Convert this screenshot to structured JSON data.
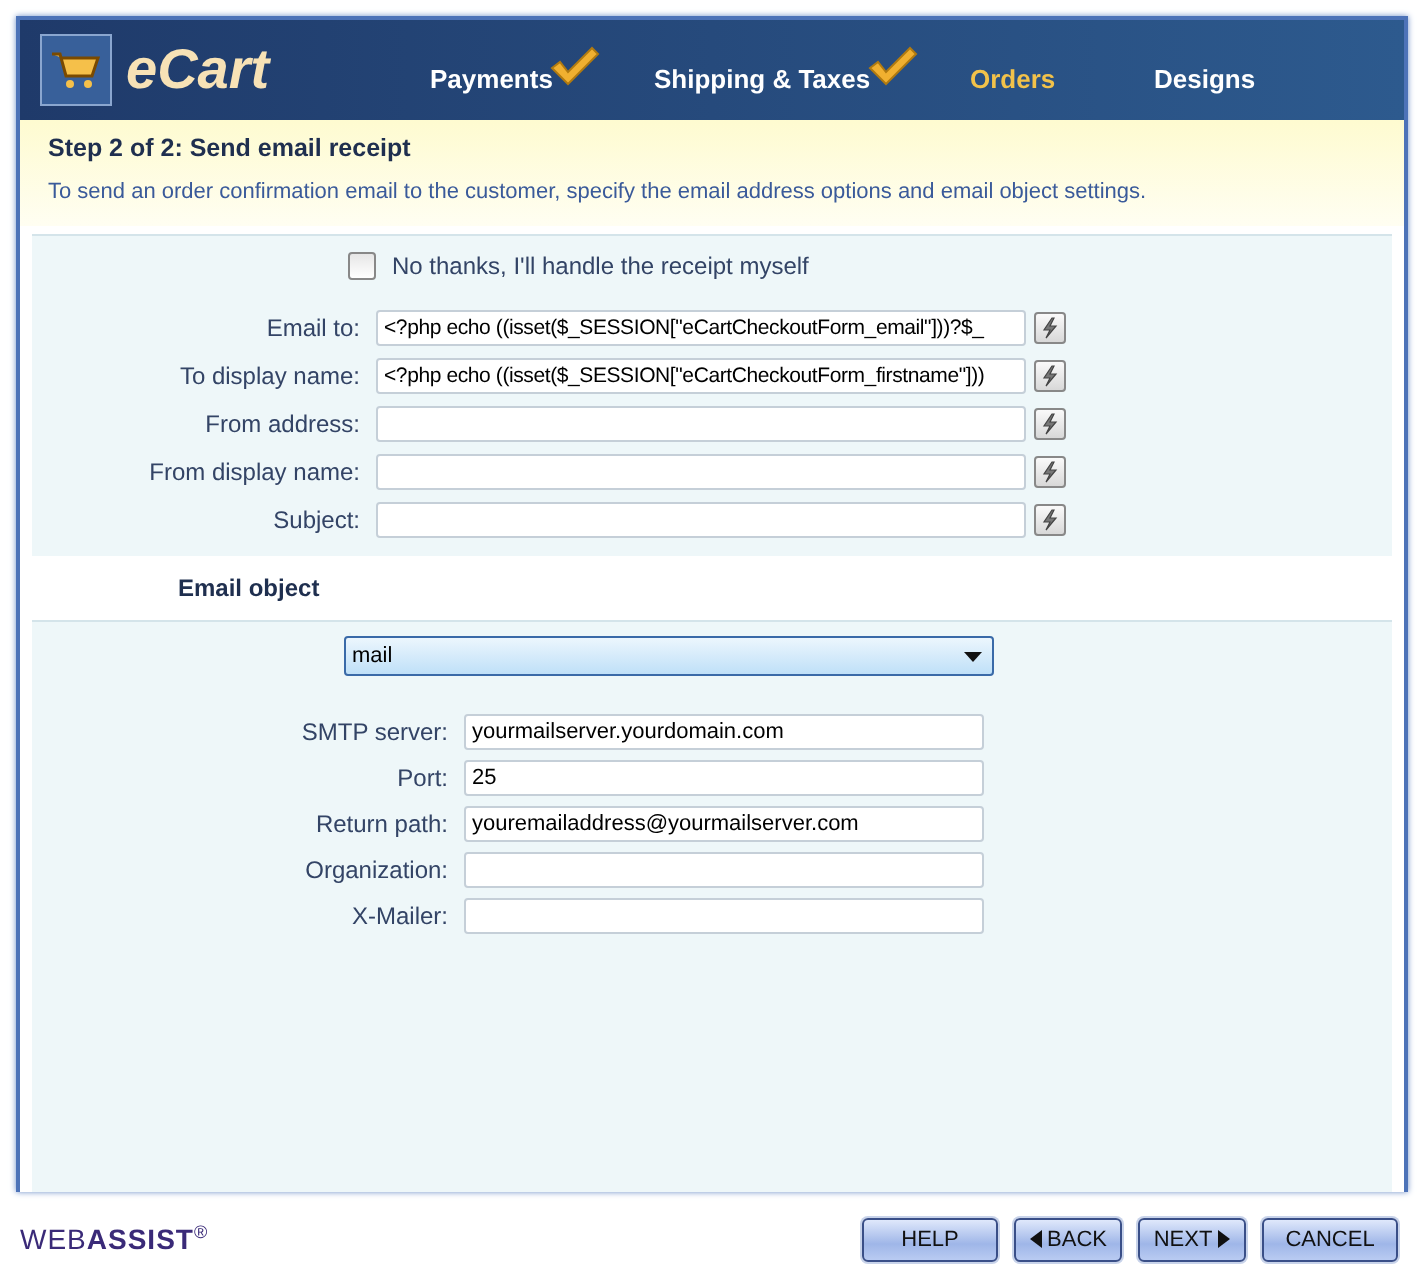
{
  "logo": "eCart",
  "tabs": [
    {
      "label": "Payments",
      "completed": true,
      "selected": false
    },
    {
      "label": "Shipping & Taxes",
      "completed": true,
      "selected": false
    },
    {
      "label": "Orders",
      "completed": false,
      "selected": true
    },
    {
      "label": "Designs",
      "completed": false,
      "selected": false
    }
  ],
  "step": {
    "title": "Step 2 of 2: Send email receipt",
    "description": "To send an order confirmation email to the customer, specify the email address options and email object settings."
  },
  "opt_out": {
    "label": "No thanks, I'll handle the receipt myself",
    "checked": false
  },
  "address_fields": [
    {
      "label": "Email to:",
      "value": "<?php echo ((isset($_SESSION[\"eCartCheckoutForm_email\"]))?$_"
    },
    {
      "label": "To display name:",
      "value": "<?php echo ((isset($_SESSION[\"eCartCheckoutForm_firstname\"]))"
    },
    {
      "label": "From address:"
    },
    {
      "label": "From display name:"
    },
    {
      "label": "Subject:"
    }
  ],
  "email_object": {
    "heading": "Email object",
    "value": "mail"
  },
  "mail_fields": [
    {
      "label": "SMTP server:",
      "value": "yourmailserver.yourdomain.com"
    },
    {
      "label": "Port:",
      "value": "25"
    },
    {
      "label": "Return path:",
      "value": "youremailaddress@yourmailserver.com"
    },
    {
      "label": "Organization:"
    },
    {
      "label": "X-Mailer:"
    }
  ],
  "brand": "WEB**ASSIST**$^{®}$",
  "buttons": [
    {
      "label": "HELP",
      "kind": "plain"
    },
    {
      "label": "BACK",
      "kind": "back"
    },
    {
      "label": "NEXT",
      "kind": "next"
    },
    {
      "label": "CANCEL",
      "kind": "plain"
    }
  ]
}
